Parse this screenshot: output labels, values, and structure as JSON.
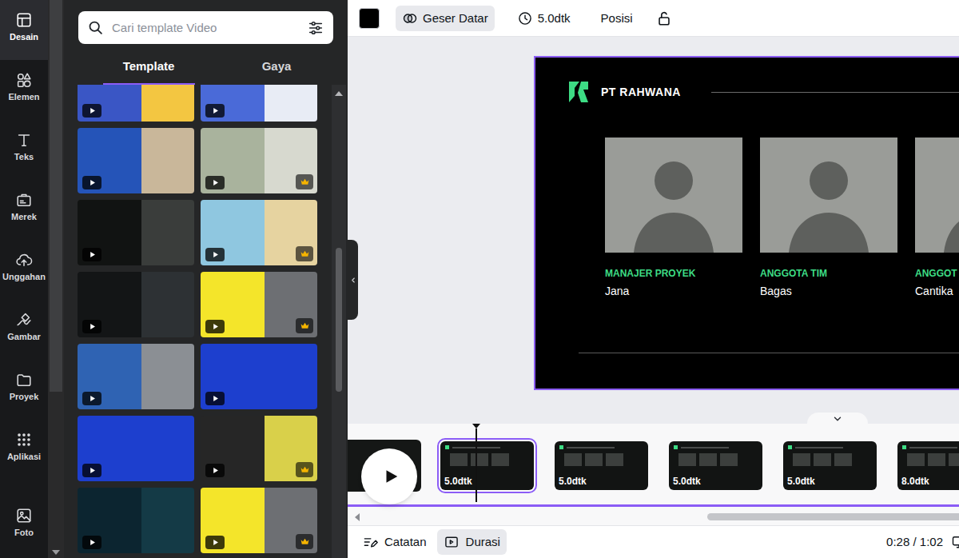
{
  "rail": {
    "items": [
      {
        "label": "Desain",
        "selected": true
      },
      {
        "label": "Elemen",
        "selected": false
      },
      {
        "label": "Teks",
        "selected": false
      },
      {
        "label": "Merek",
        "selected": false
      },
      {
        "label": "Unggahan",
        "selected": false
      },
      {
        "label": "Gambar",
        "selected": false
      },
      {
        "label": "Proyek",
        "selected": false
      },
      {
        "label": "Aplikasi",
        "selected": false
      }
    ],
    "bottom_items": [
      {
        "label": "Foto",
        "selected": false
      }
    ]
  },
  "panel": {
    "search": {
      "placeholder": "Cari template Video"
    },
    "tabs": [
      {
        "label": "Template",
        "selected": true
      },
      {
        "label": "Gaya",
        "selected": false
      }
    ],
    "templates": [
      {
        "color": "#3a56c5",
        "accent": "#f3c641",
        "premium": false
      },
      {
        "color": "#4a6ad8",
        "accent": "#e8ecf5",
        "premium": false
      },
      {
        "color": "#2554b8",
        "accent": "#c9b79a",
        "premium": false
      },
      {
        "color": "#a9b39d",
        "accent": "#d7d9cf",
        "premium": true
      },
      {
        "color": "#111312",
        "accent": "#3a3d3b",
        "premium": false
      },
      {
        "color": "#8fc7e0",
        "accent": "#e6d3a0",
        "premium": true
      },
      {
        "color": "#131516",
        "accent": "#2d3134",
        "premium": false
      },
      {
        "color": "#f4e52a",
        "accent": "#6d6f73",
        "premium": true
      },
      {
        "color": "#2f63b3",
        "accent": "#8b8f94",
        "premium": false
      },
      {
        "color": "#1d3fce",
        "accent": "#1d3fce",
        "premium": false
      },
      {
        "color": "#1d3fce",
        "accent": "#1d3fce",
        "premium": false
      },
      {
        "color": "#262626",
        "accent": "#d9d04a",
        "premium": true
      },
      {
        "color": "#0c2530",
        "accent": "#143a46",
        "premium": false
      },
      {
        "color": "#f4e52a",
        "accent": "#6d6f73",
        "premium": true
      }
    ]
  },
  "toolbar": {
    "color": "#000000",
    "items": [
      {
        "label": "Geser Datar",
        "selected": true
      },
      {
        "label": "5.0dtk",
        "selected": false
      },
      {
        "label": "Posisi",
        "selected": false
      }
    ],
    "locked": false
  },
  "slide": {
    "company": "PT RAHWANA",
    "members": [
      {
        "role": "MANAJER PROYEK",
        "name": "Jana"
      },
      {
        "role": "ANGGOTA TIM",
        "name": "Bagas"
      },
      {
        "role": "ANGGOT",
        "name": "Cantika"
      }
    ]
  },
  "timeline": {
    "pages": [
      {
        "duration": "5.0dtk",
        "selected": true
      },
      {
        "duration": "5.0dtk",
        "selected": false
      },
      {
        "duration": "5.0dtk",
        "selected": false
      },
      {
        "duration": "5.0dtk",
        "selected": false
      },
      {
        "duration": "8.0dtk",
        "selected": false
      }
    ]
  },
  "bottom_bar": {
    "items": [
      {
        "label": "Catatan",
        "selected": false
      },
      {
        "label": "Durasi",
        "selected": true
      }
    ],
    "time": "0:28 / 1:02"
  }
}
